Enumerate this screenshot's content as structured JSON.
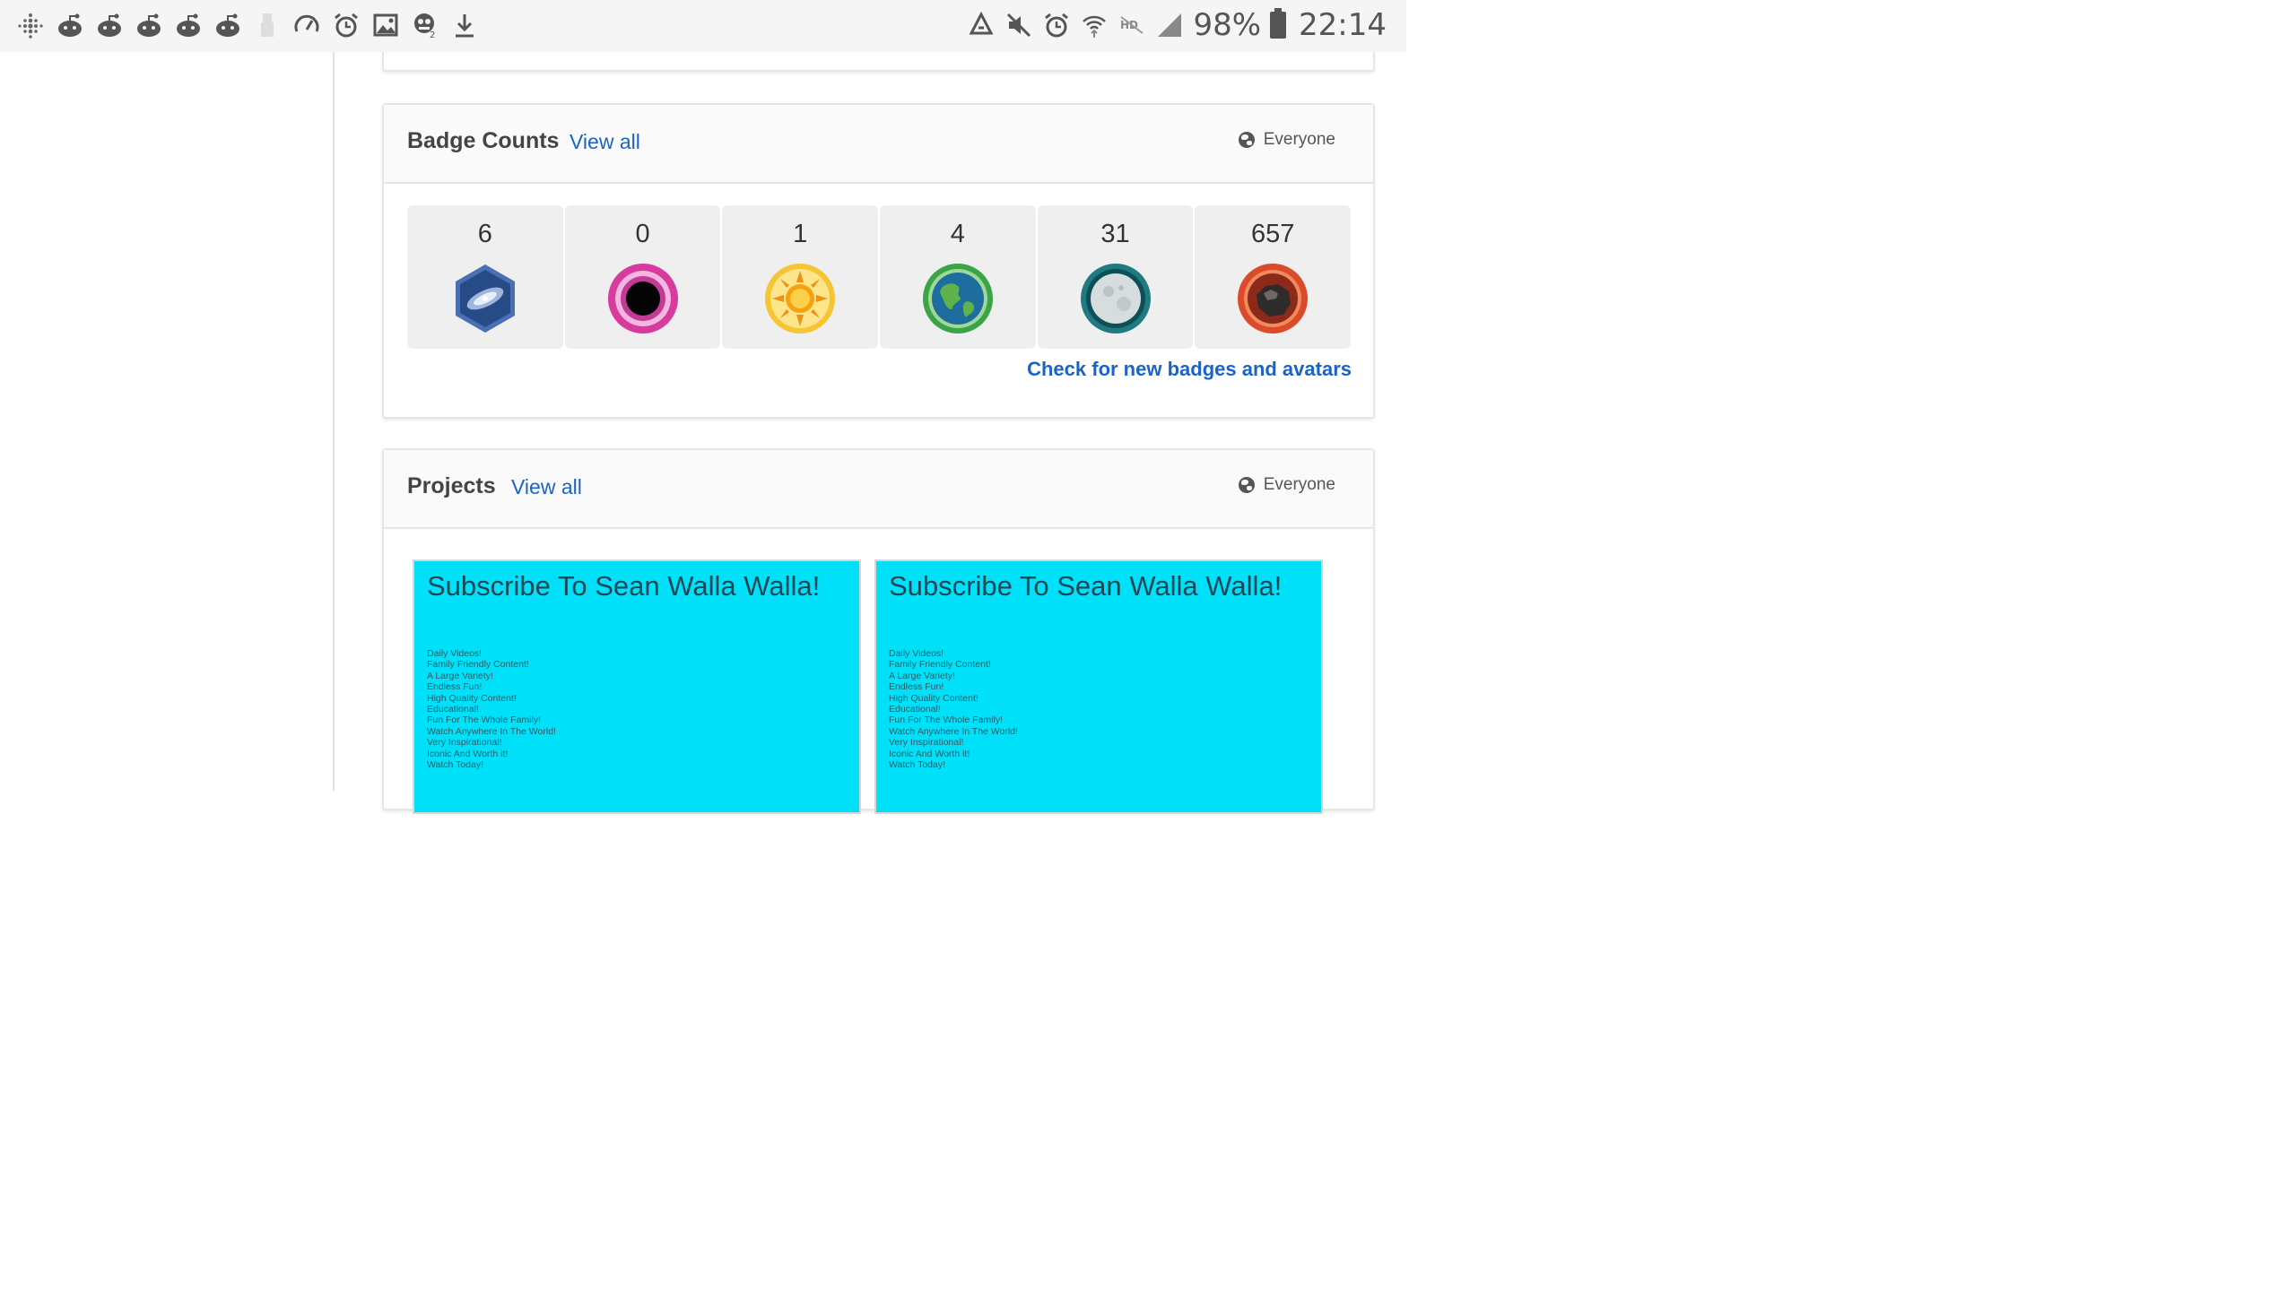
{
  "status_bar": {
    "left_icons": [
      "fitbit-icon",
      "reddit-icon",
      "reddit-icon",
      "reddit-icon",
      "reddit-icon",
      "reddit-icon",
      "usb-icon",
      "speedometer-icon",
      "alarm-icon",
      "image-icon",
      "bot-icon",
      "download-icon"
    ],
    "right_icons": [
      "recycle-icon",
      "mute-icon",
      "alarm-icon",
      "wifi-icon",
      "hd-icon",
      "signal-icon",
      "battery-icon"
    ],
    "battery": "98%",
    "time": "22:14"
  },
  "badge_counts": {
    "title": "Badge Counts",
    "view_all": "View all",
    "visibility": "Everyone",
    "badges": [
      {
        "count": "6",
        "icon": "galaxy-badge-icon",
        "color": "#4a6fb5"
      },
      {
        "count": "0",
        "icon": "black-hole-badge-icon",
        "color": "#d63b9d"
      },
      {
        "count": "1",
        "icon": "sun-badge-icon",
        "color": "#f5b81d"
      },
      {
        "count": "4",
        "icon": "earth-badge-icon",
        "color": "#3aa546"
      },
      {
        "count": "31",
        "icon": "moon-badge-icon",
        "color": "#207a82"
      },
      {
        "count": "657",
        "icon": "asteroid-badge-icon",
        "color": "#d94b2a"
      }
    ],
    "check_link": "Check for new badges and avatars"
  },
  "projects": {
    "title": "Projects",
    "view_all": "View all",
    "visibility": "Everyone",
    "items": [
      {
        "title": "Subscribe To Sean Walla Walla!",
        "lines": [
          "Daily Videos!",
          "Family Friendly Content!",
          "A Large Variety!",
          "Endless Fun!",
          "High Quality Content!",
          "Educational!",
          "Fun For The Whole Family!",
          "Watch Anywhere In The World!",
          "Very Inspirational!",
          "Iconic And Worth it!",
          "Watch Today!"
        ]
      },
      {
        "title": "Subscribe To Sean Walla Walla!",
        "lines": [
          "Daily Videos!",
          "Family Friendly Content!",
          "A Large Variety!",
          "Endless Fun!",
          "High Quality Content!",
          "Educational!",
          "Fun For The Whole Family!",
          "Watch Anywhere In The World!",
          "Very Inspirational!",
          "Iconic And Worth it!",
          "Watch Today!"
        ]
      }
    ]
  },
  "colors": {
    "accent": "#1a63c9",
    "project_bg": "#00e0f8"
  }
}
